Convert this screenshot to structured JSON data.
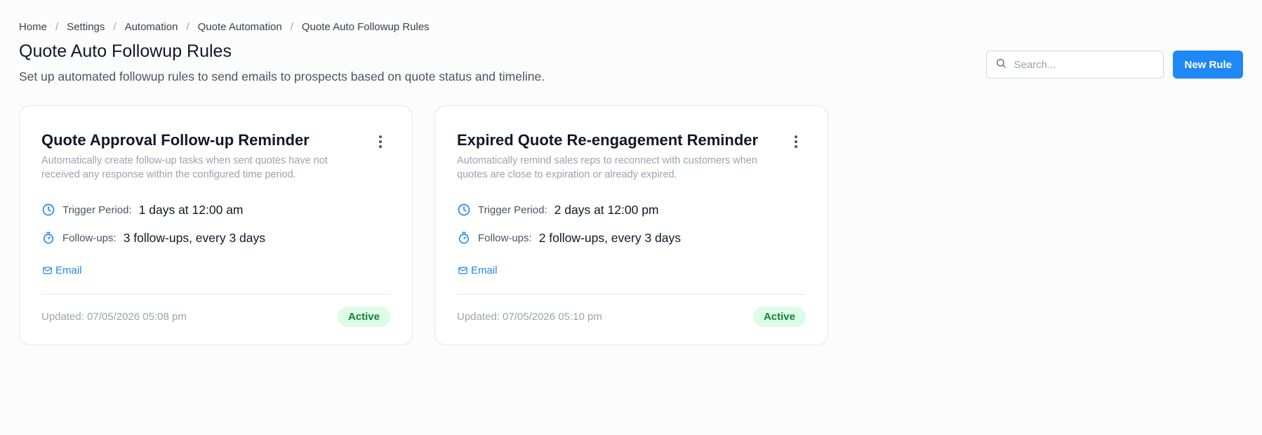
{
  "breadcrumb": {
    "items": [
      "Home",
      "Settings",
      "Automation",
      "Quote Automation",
      "Quote Auto Followup Rules"
    ],
    "separator": "/"
  },
  "header": {
    "title": "Quote Auto Followup Rules",
    "subtitle": "Set up automated followup rules to send emails to prospects based on quote status and timeline."
  },
  "search": {
    "placeholder": "Search..."
  },
  "new_rule_label": "New Rule",
  "labels": {
    "trigger_period": "Trigger Period:",
    "followups": "Follow-ups:"
  },
  "cards": [
    {
      "title": "Quote Approval Follow-up Reminder",
      "description": "Automatically create follow-up tasks when sent quotes have not received any response within the configured time period.",
      "trigger_period": "1 days at 12:00 am",
      "followups": "3 follow-ups, every 3 days",
      "channel": "Email",
      "updated": "Updated: 07/05/2026 05:08 pm",
      "status": "Active"
    },
    {
      "title": "Expired Quote Re-engagement Reminder",
      "description": "Automatically remind sales reps to reconnect with customers when quotes are close to expiration or already expired.",
      "trigger_period": "2 days at 12:00 pm",
      "followups": "2 follow-ups, every 3 days",
      "channel": "Email",
      "updated": "Updated: 07/05/2026 05:10 pm",
      "status": "Active"
    }
  ],
  "colors": {
    "accent": "#1e88f5",
    "active_bg": "#dcfce7",
    "active_text": "#15803d"
  },
  "icons": {
    "search": "search-icon",
    "trigger": "clock-icon",
    "followups": "stopwatch-icon",
    "channel": "mail-icon",
    "menu": "more-vertical-icon"
  }
}
